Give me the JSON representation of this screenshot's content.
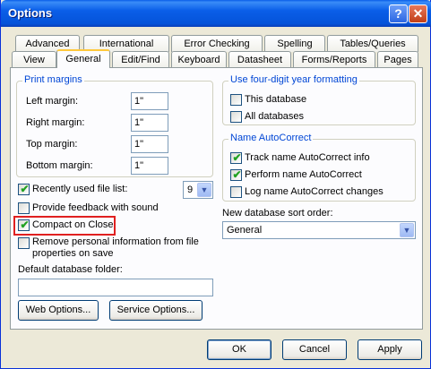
{
  "window": {
    "title": "Options"
  },
  "titlebar": {
    "help_label": "?",
    "close_label": "✕"
  },
  "tabs_back": [
    "Advanced",
    "International",
    "Error Checking",
    "Spelling",
    "Tables/Queries"
  ],
  "tabs_front": [
    "View",
    "General",
    "Edit/Find",
    "Keyboard",
    "Datasheet",
    "Forms/Reports",
    "Pages"
  ],
  "active_tab": "General",
  "print_margins": {
    "title": "Print margins",
    "left_label": "Left margin:",
    "left_value": "1\"",
    "right_label": "Right margin:",
    "right_value": "1\"",
    "top_label": "Top margin:",
    "top_value": "1\"",
    "bottom_label": "Bottom margin:",
    "bottom_value": "1\""
  },
  "recent_files": {
    "label": "Recently used file list:",
    "checked": true,
    "count": "9"
  },
  "feedback": {
    "label": "Provide feedback with sound",
    "checked": false
  },
  "compact": {
    "label": "Compact on Close",
    "checked": true
  },
  "remove_personal": {
    "label_line1": "Remove personal information from file",
    "label_line2": "properties on save",
    "checked": false
  },
  "default_folder": {
    "label": "Default database folder:",
    "value": ""
  },
  "buttons": {
    "web_options": "Web Options...",
    "service_options": "Service Options..."
  },
  "year_format": {
    "title": "Use four-digit year formatting",
    "this_db": "This database",
    "this_db_checked": false,
    "all_db": "All databases",
    "all_db_checked": false
  },
  "autocorrect": {
    "title": "Name AutoCorrect",
    "track": "Track name AutoCorrect info",
    "track_checked": true,
    "perform": "Perform name AutoCorrect",
    "perform_checked": true,
    "log": "Log name AutoCorrect changes",
    "log_checked": false
  },
  "sort_order": {
    "label": "New database sort order:",
    "value": "General"
  },
  "dialog_buttons": {
    "ok": "OK",
    "cancel": "Cancel",
    "apply": "Apply"
  },
  "colors": {
    "highlight": "#e02020",
    "group_title": "#0046d5",
    "check": "#21a121"
  }
}
